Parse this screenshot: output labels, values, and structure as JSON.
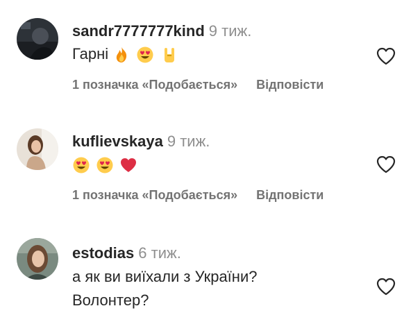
{
  "comments": [
    {
      "username": "sandr7777777kind",
      "time": "9 тиж.",
      "text": "Гарні",
      "emojis": [
        "fire-emoji",
        "heart-eyes-emoji",
        "rock-on-emoji"
      ],
      "likes": "1 позначка «Подобається»",
      "reply": "Відповісти"
    },
    {
      "username": "kuflievskaya",
      "time": "9 тиж.",
      "text": "",
      "emojis": [
        "heart-eyes-emoji",
        "heart-eyes-emoji",
        "red-heart-emoji"
      ],
      "likes": "1 позначка «Подобається»",
      "reply": "Відповісти"
    },
    {
      "username": "estodias",
      "time": "6 тиж.",
      "text_line1": "а як ви виїхали з України?",
      "text_line2": "Волонтер?"
    }
  ],
  "colors": {
    "text": "#262626",
    "muted": "#8e8e8e",
    "actions": "#737373"
  }
}
